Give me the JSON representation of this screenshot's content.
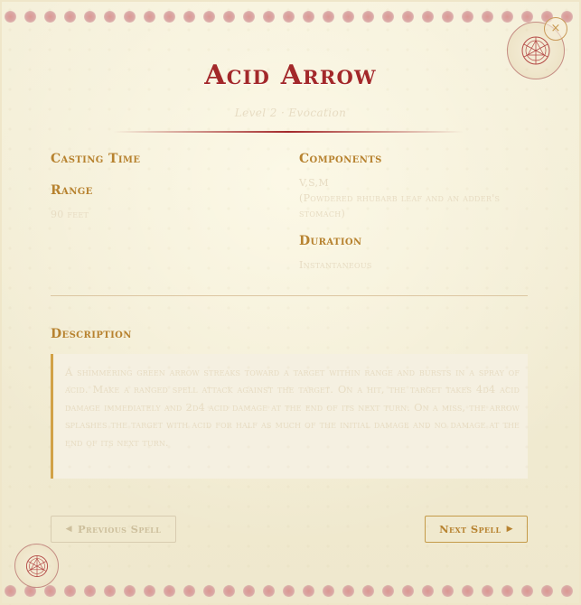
{
  "spell": {
    "title": "Acid Arrow",
    "subtitle": "Level 2 · Evocation",
    "casting_time": {
      "label": "Casting Time",
      "value": ""
    },
    "range": {
      "label": "Range",
      "value": "90 feet"
    },
    "components": {
      "label": "Components",
      "value": "V,S,M",
      "detail": "(Powdered rhubarb leaf and an adder's stomach)"
    },
    "duration": {
      "label": "Duration",
      "value": "Instantaneous"
    },
    "description": {
      "label": "Description",
      "text": "A shimmering green arrow streaks toward a target within range and bursts in a spray of acid. Make a ranged spell attack against the target. On a hit, the target takes 4d4 acid damage immediately and 2d4 acid damage at the end of its next turn. On a miss, the arrow splashes the target with acid for half as much of the initial damage and no damage at the end of its next turn."
    }
  },
  "controls": {
    "close_label": "×",
    "prev_label": "Previous Spell",
    "prev_arrow": "◀",
    "next_label": "Next Spell",
    "next_arrow": "▶"
  },
  "icons": {
    "emblem_top": "arcane-sigil-icon",
    "emblem_bottom": "arcane-sigil-icon",
    "close": "close-icon"
  },
  "colors": {
    "title": "#a3282a",
    "label": "#b7822f",
    "background": "#f1ebd3",
    "border_dots": "#d88e8a"
  }
}
